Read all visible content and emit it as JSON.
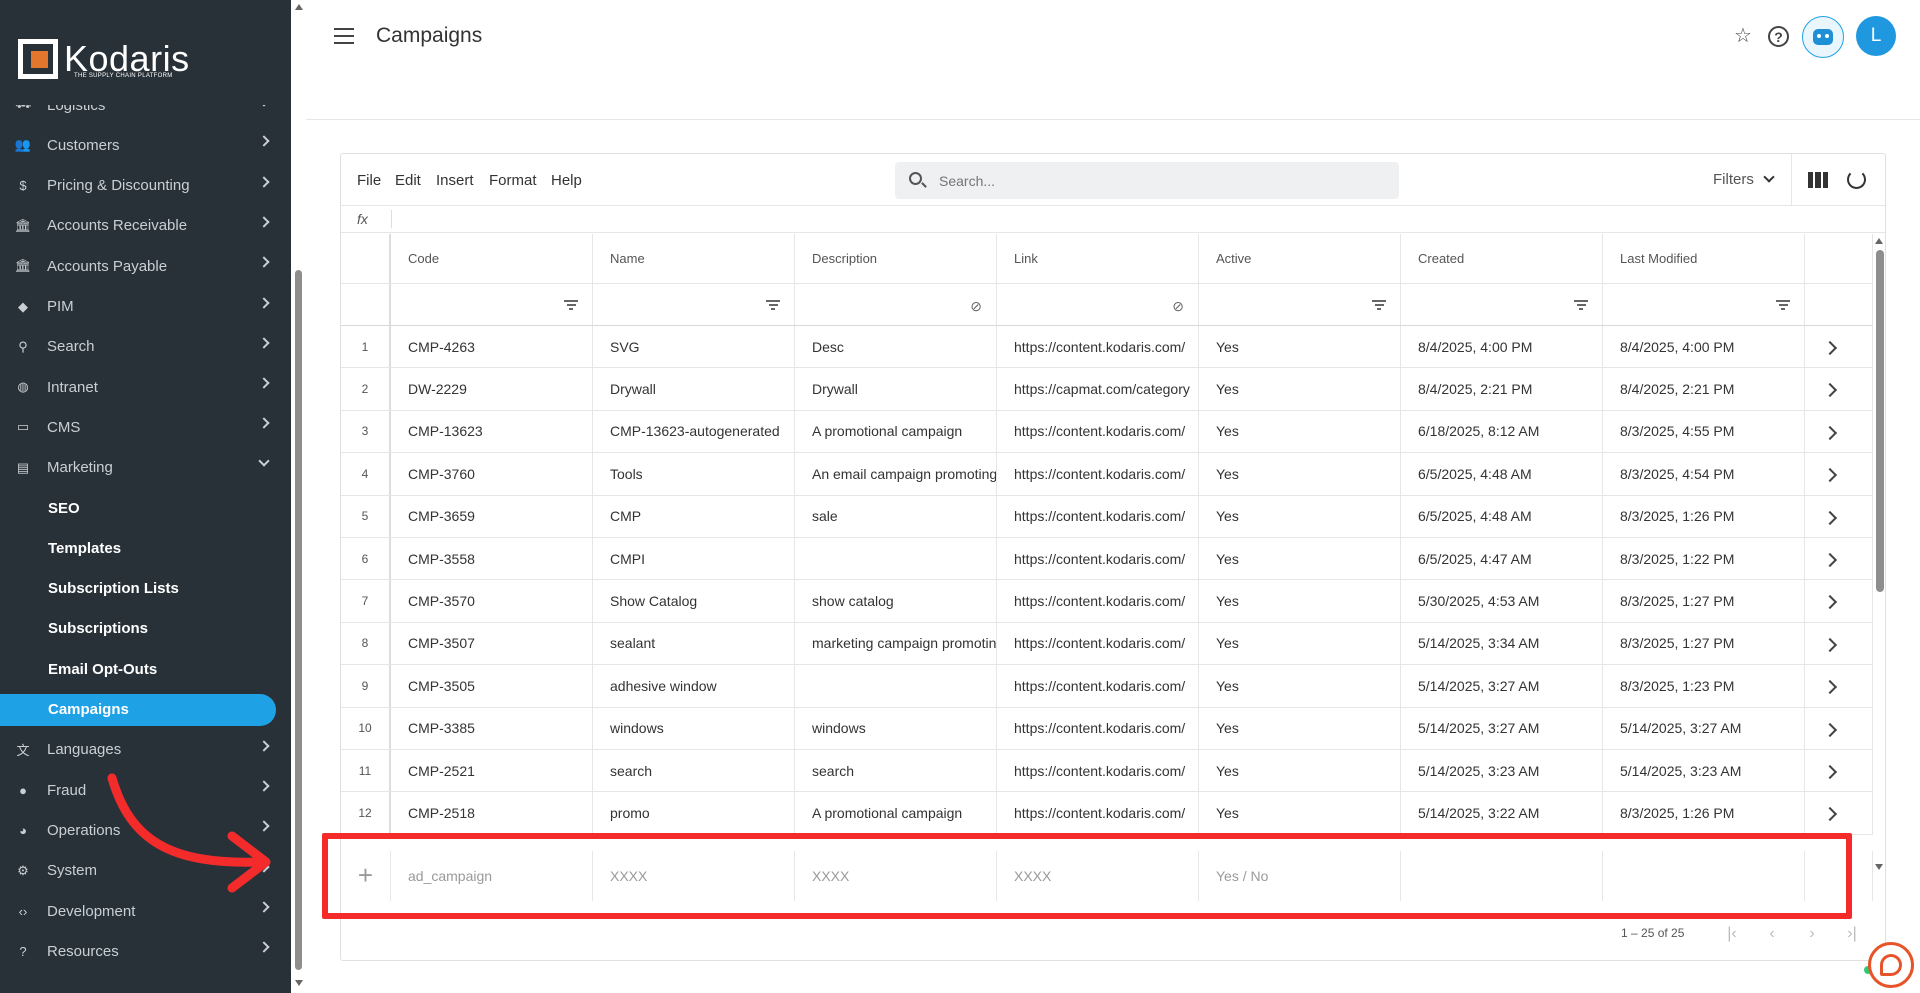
{
  "brand": {
    "name": "Kodaris",
    "tagline": "THE SUPPLY CHAIN PLATFORM"
  },
  "sidebar": {
    "items": [
      {
        "label": "Logistics",
        "icon": "truck-icon",
        "glyph": "⛟"
      },
      {
        "label": "Customers",
        "icon": "people-icon",
        "glyph": "👥"
      },
      {
        "label": "Pricing & Discounting",
        "icon": "dollar-icon",
        "glyph": "$"
      },
      {
        "label": "Accounts Receivable",
        "icon": "bank-icon",
        "glyph": "🏛"
      },
      {
        "label": "Accounts Payable",
        "icon": "bank-icon",
        "glyph": "🏛"
      },
      {
        "label": "PIM",
        "icon": "tag-icon",
        "glyph": "◆"
      },
      {
        "label": "Search",
        "icon": "search-icon",
        "glyph": "⚲"
      },
      {
        "label": "Intranet",
        "icon": "globe-icon",
        "glyph": "◍"
      },
      {
        "label": "CMS",
        "icon": "window-icon",
        "glyph": "▭"
      },
      {
        "label": "Marketing",
        "icon": "megaphone-icon",
        "glyph": "▤"
      }
    ],
    "marketing_sub": [
      "SEO",
      "Templates",
      "Subscription Lists",
      "Subscriptions",
      "Email Opt-Outs",
      "Campaigns"
    ],
    "after_items": [
      {
        "label": "Languages",
        "icon": "translate-icon",
        "glyph": "文"
      },
      {
        "label": "Fraud",
        "icon": "alert-icon",
        "glyph": "●"
      },
      {
        "label": "Operations",
        "icon": "operations-icon",
        "glyph": "◕"
      },
      {
        "label": "System",
        "icon": "gear-icon",
        "glyph": "⚙"
      },
      {
        "label": "Development",
        "icon": "code-icon",
        "glyph": "‹›"
      },
      {
        "label": "Resources",
        "icon": "help-circle-icon",
        "glyph": "?"
      }
    ]
  },
  "header": {
    "title": "Campaigns",
    "star": "☆",
    "help": "?",
    "avatar_initial": "L"
  },
  "toolbar": {
    "menus": [
      "File",
      "Edit",
      "Insert",
      "Format",
      "Help"
    ],
    "search_placeholder": "Search...",
    "filters_label": "Filters",
    "fx_label": "fx"
  },
  "table": {
    "columns": [
      "Code",
      "Name",
      "Description",
      "Link",
      "Active",
      "Created",
      "Last Modified"
    ],
    "column_filter_icons": [
      "filter",
      "filter",
      "filter-off",
      "filter-off",
      "filter",
      "filter",
      "filter"
    ],
    "rows": [
      [
        "1",
        "CMP-4263",
        "SVG",
        "Desc",
        "https://content.kodaris.com/",
        "Yes",
        "8/4/2025, 4:00 PM",
        "8/4/2025, 4:00 PM"
      ],
      [
        "2",
        "DW-2229",
        "Drywall",
        "Drywall",
        "https://capmat.com/category",
        "Yes",
        "8/4/2025, 2:21 PM",
        "8/4/2025, 2:21 PM"
      ],
      [
        "3",
        "CMP-13623",
        "CMP-13623-autogenerated",
        "A promotional campaign",
        "https://content.kodaris.com/",
        "Yes",
        "6/18/2025, 8:12 AM",
        "8/3/2025, 4:55 PM"
      ],
      [
        "4",
        "CMP-3760",
        "Tools",
        "An email campaign promoting",
        "https://content.kodaris.com/",
        "Yes",
        "6/5/2025, 4:48 AM",
        "8/3/2025, 4:54 PM"
      ],
      [
        "5",
        "CMP-3659",
        "CMP",
        "sale",
        "https://content.kodaris.com/",
        "Yes",
        "6/5/2025, 4:48 AM",
        "8/3/2025, 1:26 PM"
      ],
      [
        "6",
        "CMP-3558",
        "CMPI",
        "",
        "https://content.kodaris.com/",
        "Yes",
        "6/5/2025, 4:47 AM",
        "8/3/2025, 1:22 PM"
      ],
      [
        "7",
        "CMP-3570",
        "Show Catalog",
        "show catalog",
        "https://content.kodaris.com/",
        "Yes",
        "5/30/2025, 4:53 AM",
        "8/3/2025, 1:27 PM"
      ],
      [
        "8",
        "CMP-3507",
        "sealant",
        "marketing campaign promoting",
        "https://content.kodaris.com/",
        "Yes",
        "5/14/2025, 3:34 AM",
        "8/3/2025, 1:27 PM"
      ],
      [
        "9",
        "CMP-3505",
        "adhesive window",
        "",
        "https://content.kodaris.com/",
        "Yes",
        "5/14/2025, 3:27 AM",
        "8/3/2025, 1:23 PM"
      ],
      [
        "10",
        "CMP-3385",
        "windows",
        "windows",
        "https://content.kodaris.com/",
        "Yes",
        "5/14/2025, 3:27 AM",
        "5/14/2025, 3:27 AM"
      ],
      [
        "11",
        "CMP-2521",
        "search",
        "search",
        "https://content.kodaris.com/",
        "Yes",
        "5/14/2025, 3:23 AM",
        "5/14/2025, 3:23 AM"
      ],
      [
        "12",
        "CMP-2518",
        "promo",
        "A promotional campaign",
        "https://content.kodaris.com/",
        "Yes",
        "5/14/2025, 3:22 AM",
        "8/3/2025, 1:26 PM"
      ]
    ],
    "new_row": {
      "plus": "+",
      "placeholders": [
        "ad_campaign",
        "XXXX",
        "XXXX",
        "XXXX",
        "Yes / No",
        "",
        ""
      ]
    },
    "pagination": {
      "range": "1 – 25 of 25",
      "buttons": [
        "|‹",
        "‹",
        "›",
        "›|"
      ]
    }
  },
  "colors": {
    "sidebar_bg": "#283138",
    "accent": "#1fa1e6",
    "highlight": "#f32b2b",
    "chat": "#e8542a"
  }
}
